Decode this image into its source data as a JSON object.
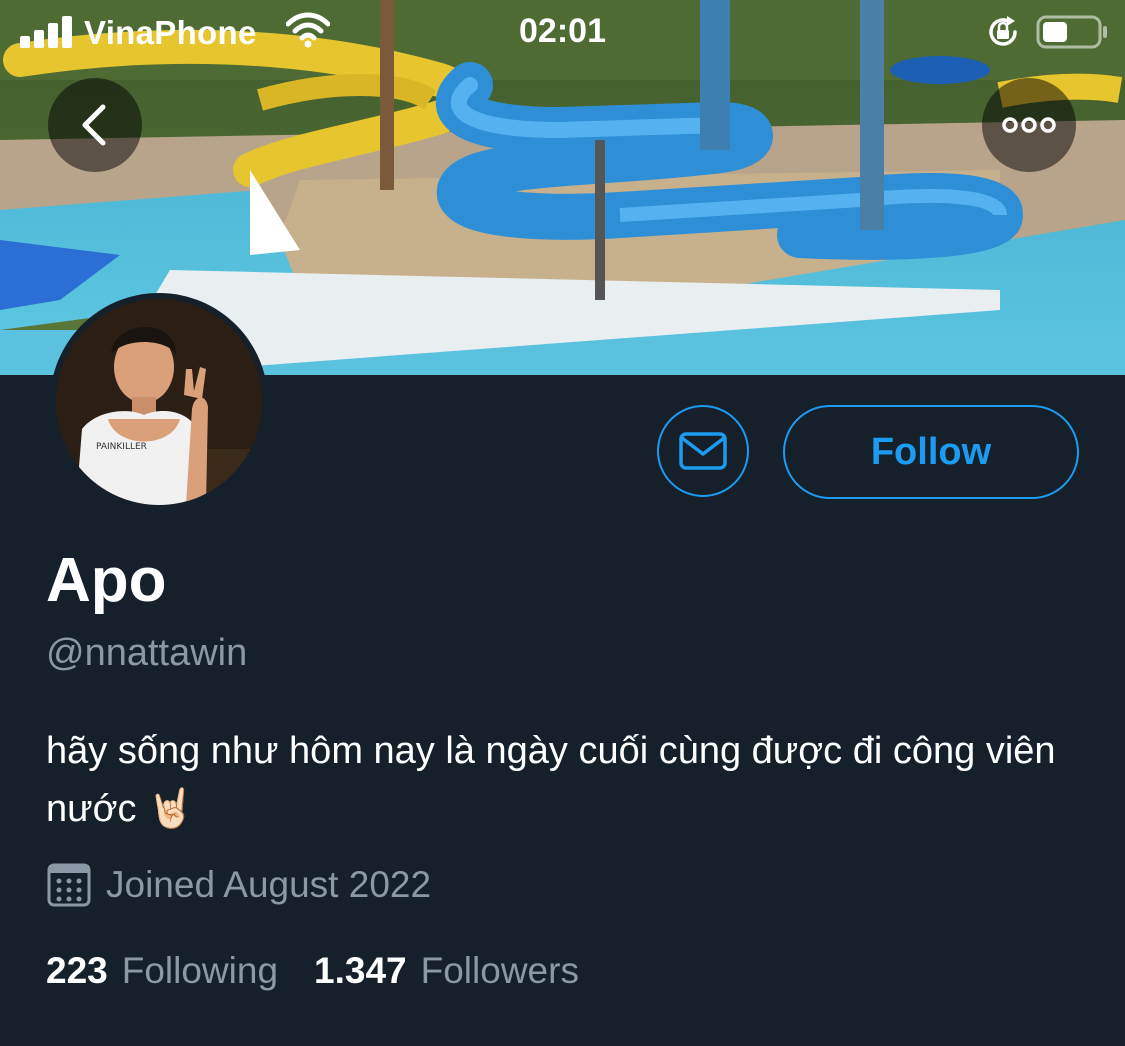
{
  "status_bar": {
    "carrier": "VinaPhone",
    "time": "02:01",
    "icons": [
      "signal-icon",
      "wifi-icon",
      "rotation-lock-icon",
      "battery-icon"
    ]
  },
  "nav": {
    "back_icon": "chevron-left-icon",
    "more_icon": "more-dots-icon"
  },
  "profile": {
    "display_name": "Apo",
    "handle": "@nnattawin",
    "bio": "hãy sống như hôm nay là ngày cuối cùng được đi công viên nước 🤘🏻",
    "joined": "Joined August 2022",
    "joined_icon": "calendar-icon",
    "following_count": "223",
    "following_label": "Following",
    "followers_count": "1.347",
    "followers_label": "Followers"
  },
  "actions": {
    "message_icon": "envelope-icon",
    "follow_label": "Follow"
  },
  "colors": {
    "background": "#15202b",
    "accent": "#1d9bf0",
    "secondary_text": "#8b98a5",
    "primary_text": "#ffffff"
  }
}
